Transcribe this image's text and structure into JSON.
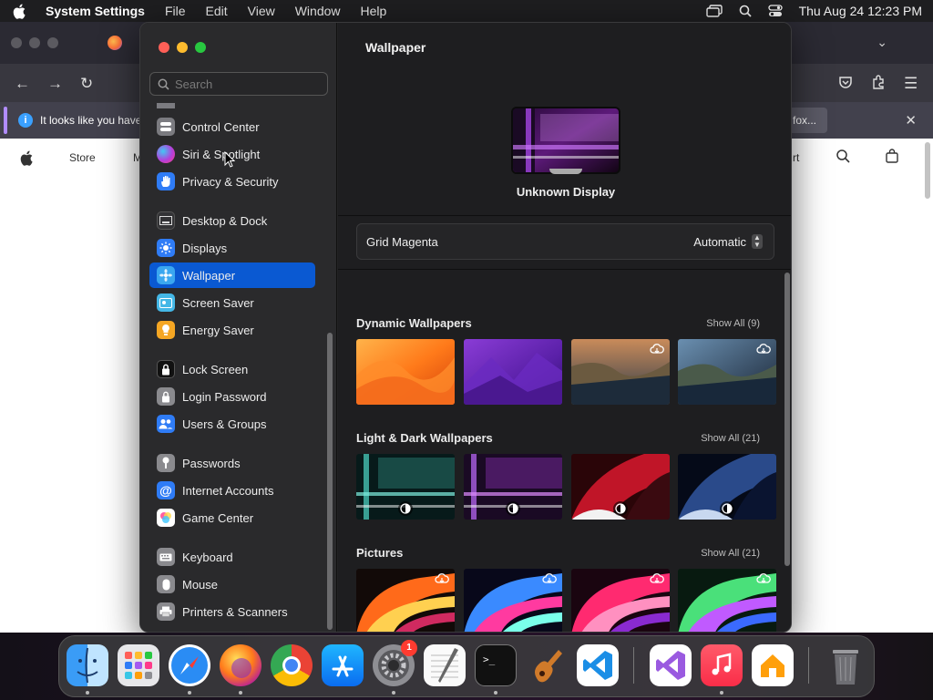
{
  "menubar": {
    "app_name": "System Settings",
    "items": [
      "File",
      "Edit",
      "View",
      "Window",
      "Help"
    ],
    "clock": "Thu Aug 24  12:23 PM"
  },
  "browser": {
    "notice_text": "It looks like you have",
    "notice_button": "fox...",
    "nav": {
      "store": "Store",
      "m": "M",
      "rt": "rt"
    }
  },
  "settings": {
    "search_placeholder": "Search",
    "sidebar": [
      {
        "label": "Control Center",
        "icon": "control-center-icon",
        "color": "#7b7b80"
      },
      {
        "label": "Siri & Spotlight",
        "icon": "siri-icon",
        "color": "#c03ad6"
      },
      {
        "label": "Privacy & Security",
        "icon": "hand-icon",
        "color": "#2f7cf6"
      },
      {
        "label": "Desktop & Dock",
        "icon": "desktop-dock-icon",
        "color": "#333336"
      },
      {
        "label": "Displays",
        "icon": "displays-icon",
        "color": "#2f7cf6"
      },
      {
        "label": "Wallpaper",
        "icon": "wallpaper-icon",
        "color": "#3aa7f0"
      },
      {
        "label": "Screen Saver",
        "icon": "screen-saver-icon",
        "color": "#44b7e6"
      },
      {
        "label": "Energy Saver",
        "icon": "energy-saver-icon",
        "color": "#f5a623"
      },
      {
        "label": "Lock Screen",
        "icon": "lock-icon",
        "color": "#222224"
      },
      {
        "label": "Login Password",
        "icon": "login-password-icon",
        "color": "#8a8a8e"
      },
      {
        "label": "Users & Groups",
        "icon": "users-icon",
        "color": "#2f7cf6"
      },
      {
        "label": "Passwords",
        "icon": "key-icon",
        "color": "#8a8a8e"
      },
      {
        "label": "Internet Accounts",
        "icon": "at-icon",
        "color": "#2f7cf6"
      },
      {
        "label": "Game Center",
        "icon": "game-center-icon",
        "color": "#ffffff"
      },
      {
        "label": "Keyboard",
        "icon": "keyboard-icon",
        "color": "#8a8a8e"
      },
      {
        "label": "Mouse",
        "icon": "mouse-icon",
        "color": "#8a8a8e"
      },
      {
        "label": "Printers & Scanners",
        "icon": "printer-icon",
        "color": "#8a8a8e"
      }
    ],
    "active_item": "Wallpaper",
    "pane_title": "Wallpaper",
    "display_name": "Unknown Display",
    "current_wallpaper": "Grid Magenta",
    "mode_select": "Automatic",
    "sections": [
      {
        "title": "Dynamic Wallpapers",
        "show_all": "Show All (9)"
      },
      {
        "title": "Light & Dark Wallpapers",
        "show_all": "Show All (21)"
      },
      {
        "title": "Pictures",
        "show_all": "Show All (21)"
      }
    ]
  },
  "dock": {
    "apps": [
      "Finder",
      "Launchpad",
      "Safari",
      "Firefox",
      "Chrome",
      "App Store",
      "System Settings",
      "TextEdit",
      "Terminal",
      "GarageBand",
      "Visual Studio Code",
      "Visual Studio",
      "Music",
      "Home",
      "Trash"
    ],
    "badge_count": "1"
  }
}
